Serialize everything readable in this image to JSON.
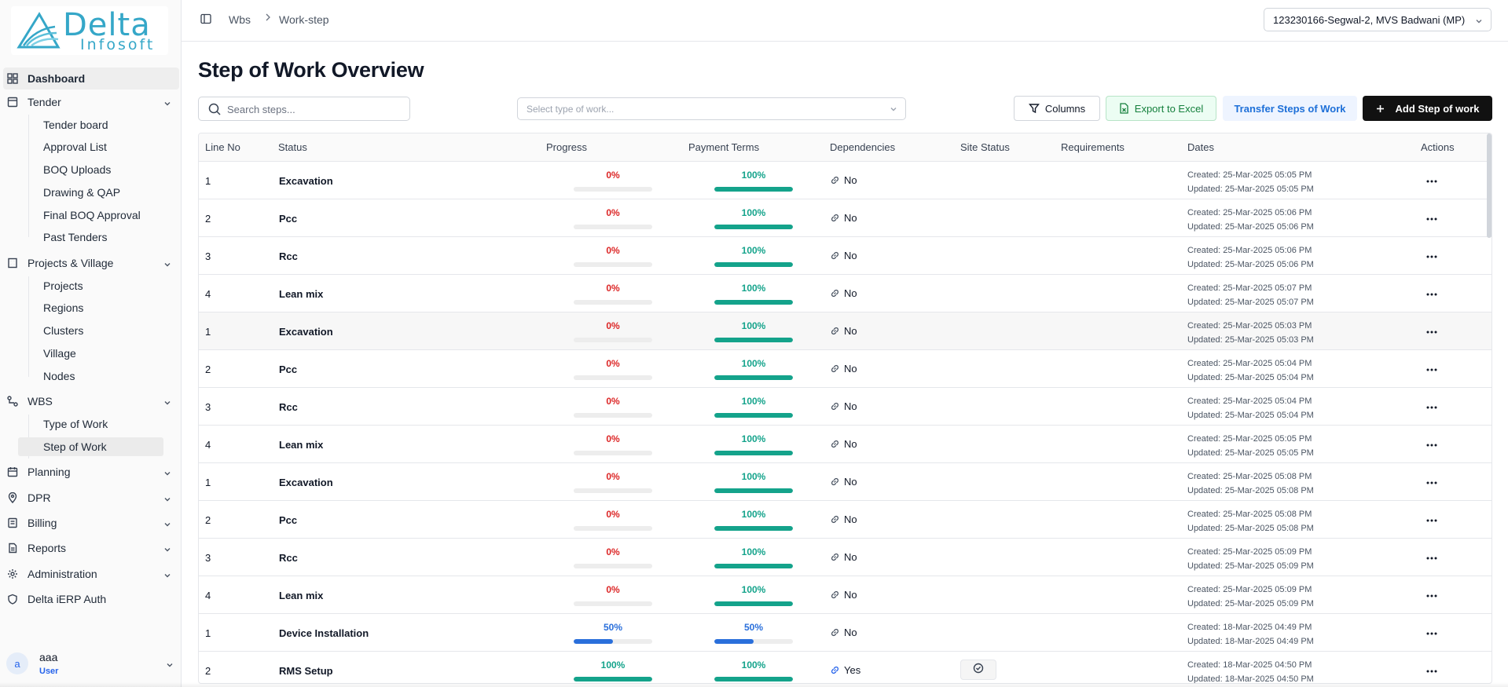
{
  "brand": {
    "name_line1": "Delta",
    "name_line2": "Infosoft"
  },
  "colors": {
    "red": "#dc2626",
    "teal": "#14a38b",
    "blue": "#2a6fdb",
    "accent_blue": "#2563eb"
  },
  "sidebar": {
    "items": [
      {
        "label": "Dashboard",
        "icon": "dashboard-icon",
        "active": true
      },
      {
        "label": "Tender",
        "icon": "tender-icon",
        "expanded": true,
        "children": [
          "Tender board",
          "Approval List",
          "BOQ Uploads",
          "Drawing & QAP",
          "Final BOQ Approval",
          "Past Tenders"
        ]
      },
      {
        "label": "Projects & Village",
        "icon": "building-icon",
        "expanded": true,
        "children": [
          "Projects",
          "Regions",
          "Clusters",
          "Village",
          "Nodes"
        ]
      },
      {
        "label": "WBS",
        "icon": "wbs-icon",
        "expanded": true,
        "children": [
          "Type of Work",
          "Step of Work"
        ],
        "selected_child": "Step of Work"
      },
      {
        "label": "Planning",
        "icon": "planning-icon"
      },
      {
        "label": "DPR",
        "icon": "map-pin-icon"
      },
      {
        "label": "Billing",
        "icon": "billing-icon"
      },
      {
        "label": "Reports",
        "icon": "reports-icon"
      },
      {
        "label": "Administration",
        "icon": "gear-icon"
      },
      {
        "label": "Delta iERP Auth",
        "icon": "shield-icon"
      }
    ]
  },
  "user": {
    "initial": "a",
    "name": "aaa",
    "role": "User"
  },
  "header": {
    "breadcrumbs": [
      "Wbs",
      "Work-step"
    ],
    "project_select": "123230166-Segwal-2, MVS Badwani (MP)"
  },
  "main": {
    "title": "Step of Work Overview",
    "search_placeholder": "Search steps...",
    "type_placeholder": "Select type of work...",
    "buttons": {
      "columns": "Columns",
      "export": "Export to Excel",
      "transfer": "Transfer Steps of Work",
      "add": "Add Step of work"
    }
  },
  "table": {
    "columns": [
      "Line No",
      "Status",
      "Progress",
      "Payment Terms",
      "Dependencies",
      "Site Status",
      "Requirements",
      "Dates",
      "Actions"
    ],
    "rows": [
      {
        "line": "1",
        "status": "Excavation",
        "progress": "0%",
        "progress_value": 0,
        "payment": "100%",
        "payment_value": 100,
        "dependency": "No",
        "created": "Created: 25-Mar-2025 05:05 PM",
        "updated": "Updated: 25-Mar-2025 05:05 PM"
      },
      {
        "line": "2",
        "status": "Pcc",
        "progress": "0%",
        "progress_value": 0,
        "payment": "100%",
        "payment_value": 100,
        "dependency": "No",
        "created": "Created: 25-Mar-2025 05:06 PM",
        "updated": "Updated: 25-Mar-2025 05:06 PM"
      },
      {
        "line": "3",
        "status": "Rcc",
        "progress": "0%",
        "progress_value": 0,
        "payment": "100%",
        "payment_value": 100,
        "dependency": "No",
        "created": "Created: 25-Mar-2025 05:06 PM",
        "updated": "Updated: 25-Mar-2025 05:06 PM"
      },
      {
        "line": "4",
        "status": "Lean mix",
        "progress": "0%",
        "progress_value": 0,
        "payment": "100%",
        "payment_value": 100,
        "dependency": "No",
        "created": "Created: 25-Mar-2025 05:07 PM",
        "updated": "Updated: 25-Mar-2025 05:07 PM"
      },
      {
        "line": "1",
        "status": "Excavation",
        "progress": "0%",
        "progress_value": 0,
        "payment": "100%",
        "payment_value": 100,
        "dependency": "No",
        "created": "Created: 25-Mar-2025 05:03 PM",
        "updated": "Updated: 25-Mar-2025 05:03 PM",
        "hover": true
      },
      {
        "line": "2",
        "status": "Pcc",
        "progress": "0%",
        "progress_value": 0,
        "payment": "100%",
        "payment_value": 100,
        "dependency": "No",
        "created": "Created: 25-Mar-2025 05:04 PM",
        "updated": "Updated: 25-Mar-2025 05:04 PM"
      },
      {
        "line": "3",
        "status": "Rcc",
        "progress": "0%",
        "progress_value": 0,
        "payment": "100%",
        "payment_value": 100,
        "dependency": "No",
        "created": "Created: 25-Mar-2025 05:04 PM",
        "updated": "Updated: 25-Mar-2025 05:04 PM"
      },
      {
        "line": "4",
        "status": "Lean mix",
        "progress": "0%",
        "progress_value": 0,
        "payment": "100%",
        "payment_value": 100,
        "dependency": "No",
        "created": "Created: 25-Mar-2025 05:05 PM",
        "updated": "Updated: 25-Mar-2025 05:05 PM"
      },
      {
        "line": "1",
        "status": "Excavation",
        "progress": "0%",
        "progress_value": 0,
        "payment": "100%",
        "payment_value": 100,
        "dependency": "No",
        "created": "Created: 25-Mar-2025 05:08 PM",
        "updated": "Updated: 25-Mar-2025 05:08 PM"
      },
      {
        "line": "2",
        "status": "Pcc",
        "progress": "0%",
        "progress_value": 0,
        "payment": "100%",
        "payment_value": 100,
        "dependency": "No",
        "created": "Created: 25-Mar-2025 05:08 PM",
        "updated": "Updated: 25-Mar-2025 05:08 PM"
      },
      {
        "line": "3",
        "status": "Rcc",
        "progress": "0%",
        "progress_value": 0,
        "payment": "100%",
        "payment_value": 100,
        "dependency": "No",
        "created": "Created: 25-Mar-2025 05:09 PM",
        "updated": "Updated: 25-Mar-2025 05:09 PM"
      },
      {
        "line": "4",
        "status": "Lean mix",
        "progress": "0%",
        "progress_value": 0,
        "payment": "100%",
        "payment_value": 100,
        "dependency": "No",
        "created": "Created: 25-Mar-2025 05:09 PM",
        "updated": "Updated: 25-Mar-2025 05:09 PM"
      },
      {
        "line": "1",
        "status": "Device Installation",
        "progress": "50%",
        "progress_value": 50,
        "payment": "50%",
        "payment_value": 50,
        "dependency": "No",
        "created": "Created: 18-Mar-2025 04:49 PM",
        "updated": "Updated: 18-Mar-2025 04:49 PM"
      },
      {
        "line": "2",
        "status": "RMS Setup",
        "progress": "100%",
        "progress_value": 100,
        "payment": "100%",
        "payment_value": 100,
        "dependency": "Yes",
        "site_status_icon": "check-circle-icon",
        "created": "Created: 18-Mar-2025 04:50 PM",
        "updated": "Updated: 18-Mar-2025 04:50 PM"
      }
    ]
  }
}
